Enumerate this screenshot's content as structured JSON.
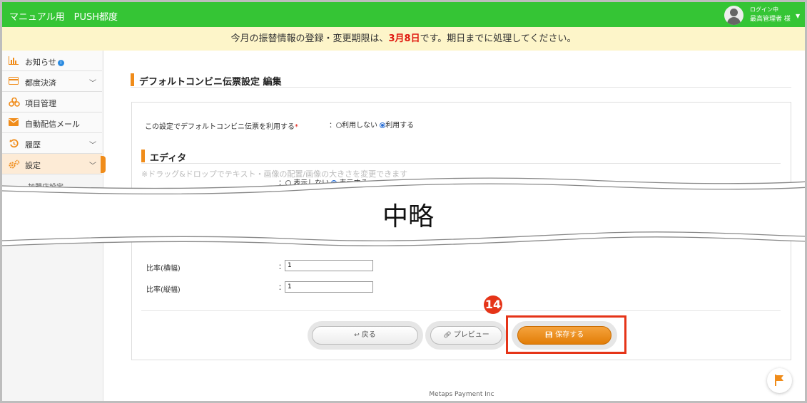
{
  "header": {
    "app_title": "マニュアル用　PUSH都度",
    "user_status": "ログイン中",
    "user_name": "最高管理者 様",
    "caret": "▼"
  },
  "notice": {
    "prefix": "今月の振替情報の登録・変更期限は、",
    "deadline": "3月8日",
    "suffix": "です。期日までに処理してください。"
  },
  "sidebar": {
    "items": [
      {
        "label": "お知らせ",
        "icon": "bar-chart-icon",
        "badge": "i"
      },
      {
        "label": "都度決済",
        "icon": "card-icon",
        "chevron": "﹀"
      },
      {
        "label": "項目管理",
        "icon": "cubes-icon"
      },
      {
        "label": "自動配信メール",
        "icon": "envelope-icon"
      },
      {
        "label": "履歴",
        "icon": "history-icon",
        "chevron": "﹀"
      },
      {
        "label": "設定",
        "icon": "cogs-icon",
        "chevron": "﹀"
      }
    ],
    "sub_item": "加盟店設定"
  },
  "page": {
    "heading": "デフォルトコンビニ伝票設定 編集",
    "setting_label": "この設定でデフォルトコンビニ伝票を利用する",
    "required_mark": "*",
    "colon": "：",
    "opt_off": "利用しない",
    "opt_on": "利用する",
    "editor_heading": "エディタ",
    "editor_note": "※ドラッグ&ドロップでテキスト・画像の配置/画像の大きさを変更できます",
    "display_off": "表示しない",
    "display_on": "表示する",
    "omitted": "中略",
    "ratio_width_label": "比率(横幅)",
    "ratio_width_value": "1",
    "ratio_height_label": "比率(縦幅)",
    "ratio_height_value": "1"
  },
  "buttons": {
    "back": "戻る",
    "preview": "プレビュー",
    "save": "保存する"
  },
  "annotation": {
    "step_number": "14",
    "color": "#e53418"
  },
  "footer": {
    "text": "Metaps Payment Inc"
  },
  "colors": {
    "header_green": "#35c535",
    "accent_orange": "#f08c1a",
    "notice_bg": "#fdf5c9",
    "deadline_red": "#e0190f"
  }
}
